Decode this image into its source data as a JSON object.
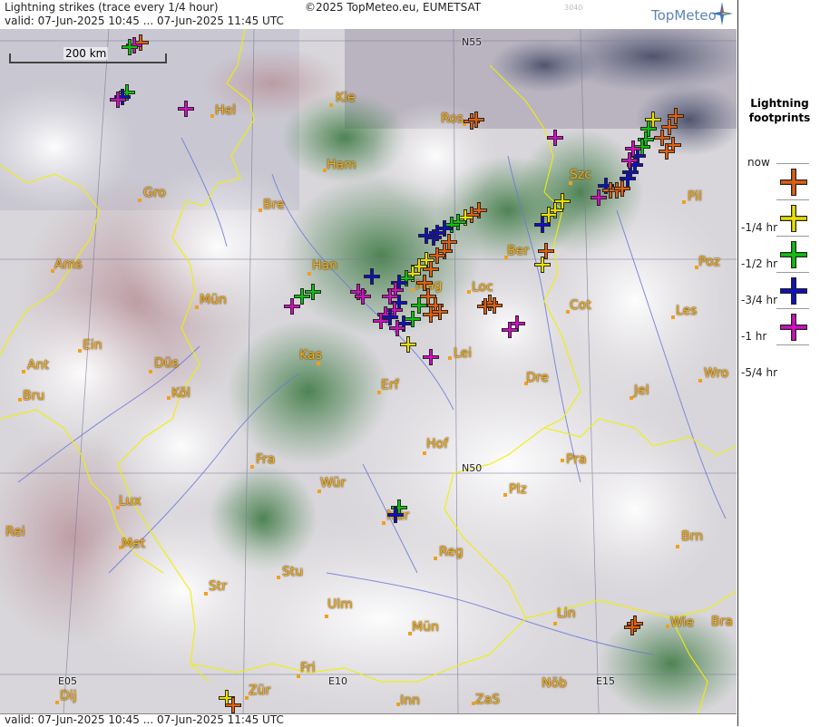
{
  "header": {
    "title": "Lightning strikes (trace every 1/4 hour)",
    "valid": "valid:  07-Jun-2025 10:45 ... 07-Jun-2025 11:45 UTC",
    "copyright": "©2025 TopMeteo.eu, EUMETSAT",
    "code": "3040",
    "logo": "TopMeteo"
  },
  "footer": {
    "valid": "valid:  07-Jun-2025 10:45 ... 07-Jun-2025 11:45 UTC"
  },
  "scale_bar": "200 km",
  "legend": {
    "title": "Lightning footprints",
    "entries": [
      {
        "label": "now",
        "color": "#e06010"
      },
      {
        "label": "-1/4 hr",
        "color": "#e8e000"
      },
      {
        "label": "-1/2 hr",
        "color": "#10c010"
      },
      {
        "label": "-3/4 hr",
        "color": "#1010c0"
      },
      {
        "label": "-1 hr",
        "color": "#d010c0"
      },
      {
        "label": "-5/4 hr",
        "color": ""
      }
    ]
  },
  "grid_labels": {
    "n55": "N55",
    "n50": "N50",
    "e05": "E05",
    "e10": "E10",
    "e15": "E15"
  },
  "cities": {
    "hel": "Hel",
    "kie": "Kie",
    "ros": "Ros",
    "ham": "Ham",
    "szc": "Szc",
    "gro": "Gro",
    "bre": "Bre",
    "pil": "Pil",
    "ber": "Ber",
    "ams": "Ams",
    "han": "Han",
    "poz": "Poz",
    "mag": "Mag",
    "loc": "Loc",
    "mun": "Mün",
    "cot": "Cot",
    "les": "Les",
    "ein": "Ein",
    "kas": "Kas",
    "lei": "Lei",
    "ant": "Ant",
    "dus": "Düs",
    "wro": "Wro",
    "bru": "Bru",
    "kol": "Köl",
    "erf": "Erf",
    "dre": "Dre",
    "jel": "Jel",
    "hof": "Hof",
    "fra": "Fra",
    "pra": "Pra",
    "wur": "Wür",
    "lux": "Lux",
    "plz": "Plz",
    "rei": "Rei",
    "nur": "Nür",
    "met": "Met",
    "reg": "Reg",
    "brn": "Brn",
    "stu": "Stu",
    "str": "Str",
    "ulm": "Ulm",
    "lin": "Lin",
    "mün": "Mün",
    "wie": "Wie",
    "bra": "Bra",
    "fri": "Fri",
    "dij": "Dij",
    "zur": "Zür",
    "nob": "Nöb",
    "inn": "Inn",
    "zas": "ZaS"
  },
  "colors": {
    "now": "#e06010",
    "q1": "#e8e000",
    "q2": "#10c010",
    "q3": "#1010c0",
    "q4": "#d010c0",
    "city": "#f0b020",
    "border": "#f0f000",
    "river": "#6a7ad8"
  }
}
